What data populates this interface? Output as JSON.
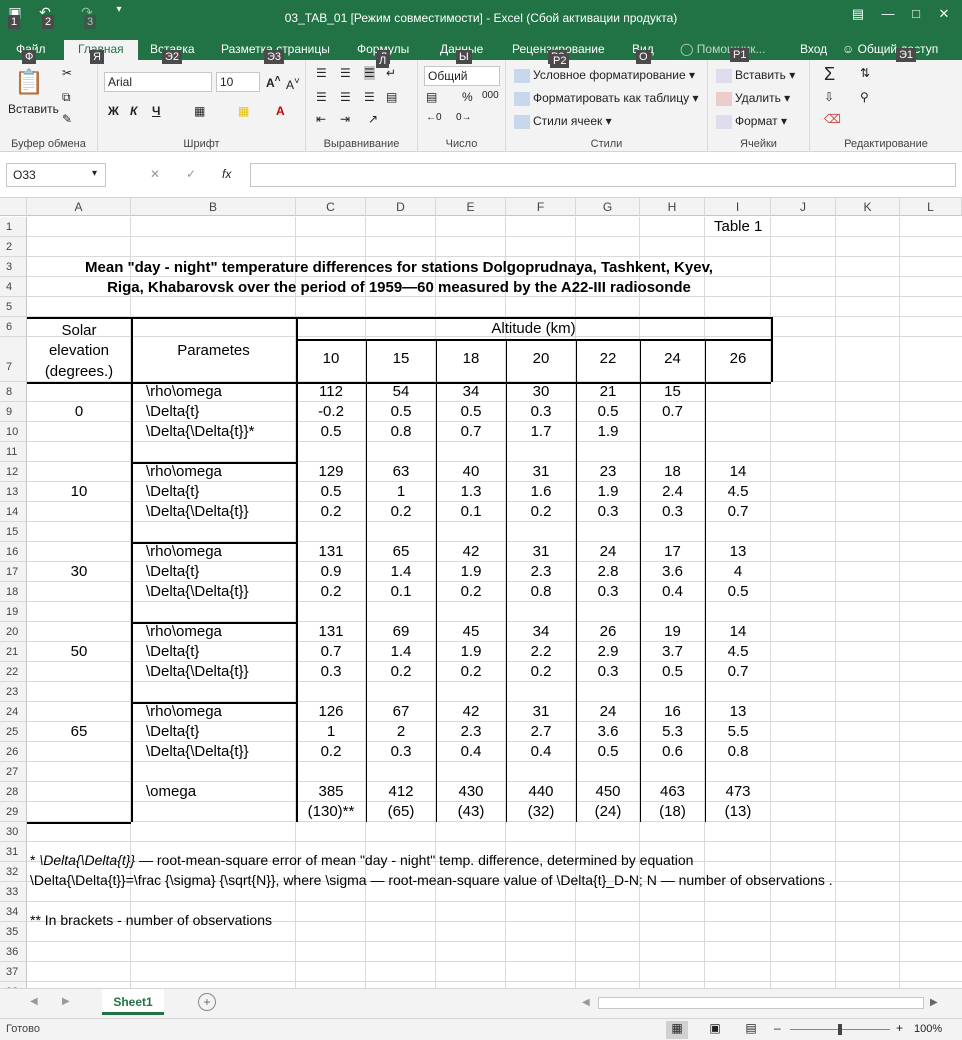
{
  "app": {
    "doc_title": "03_TAB_01  [Режим совместимости] - Excel (Сбой активации продукта)",
    "keytips_qat": [
      "1",
      "2",
      "3"
    ],
    "keytips_tabs": [
      "Ф",
      "Я",
      "Э2",
      "Э3",
      "Л",
      "Ы",
      "Р2",
      "О",
      "Р1",
      "Э1"
    ]
  },
  "tabs": [
    "Файл",
    "Главная",
    "Вставка",
    "Разметка страницы",
    "Формулы",
    "Данные",
    "Рецензирование",
    "Вид",
    "Помощник...",
    "Вход",
    "Общий доступ"
  ],
  "ribbon": {
    "clipboard": {
      "paste": "Вставить",
      "label": "Буфер обмена"
    },
    "font": {
      "name": "Arial",
      "size": "10",
      "label": "Шрифт",
      "bold": "Ж",
      "italic": "К",
      "underline": "Ч"
    },
    "alignment": {
      "label": "Выравнивание"
    },
    "number": {
      "format": "Общий",
      "label": "Число",
      "percent": "%",
      "thousands": "000"
    },
    "styles": {
      "cond": "Условное форматирование",
      "table": "Форматировать как таблицу",
      "cell": "Стили ячеек",
      "label": "Стили"
    },
    "cells": {
      "insert": "Вставить",
      "delete": "Удалить",
      "format": "Формат",
      "label": "Ячейки"
    },
    "editing": {
      "label": "Редактирование"
    }
  },
  "formula_bar": {
    "name_box": "O33",
    "fx": "fx",
    "value": ""
  },
  "columns": [
    "A",
    "B",
    "C",
    "D",
    "E",
    "F",
    "G",
    "H",
    "I",
    "J",
    "K",
    "L"
  ],
  "rows": [
    "1",
    "2",
    "3",
    "4",
    "5",
    "6",
    "7",
    "8",
    "9",
    "10",
    "11",
    "12",
    "13",
    "14",
    "15",
    "16",
    "17",
    "18",
    "19",
    "20",
    "21",
    "22",
    "23",
    "24",
    "25",
    "26",
    "27",
    "28",
    "29",
    "30",
    "31",
    "32",
    "33",
    "34",
    "35",
    "36",
    "37",
    "38"
  ],
  "sheet": {
    "table_label": "Table 1",
    "title1": "Mean \"day - night\" temperature differences for stations Dolgoprudnaya, Tashkent, Kyev,",
    "title2": "Riga, Khabarovsk over the period of 1959—60 measured by the A22-III radiosonde",
    "hdr_solar": "Solar",
    "hdr_elevation": "elevation",
    "hdr_degrees": "(degrees.)",
    "hdr_params": "Parametes",
    "hdr_altitude": "Altitude (km)",
    "altitudes": [
      "10",
      "15",
      "18",
      "20",
      "22",
      "24",
      "26"
    ],
    "groups": [
      {
        "elev": "0",
        "rows": [
          {
            "p": "\\rho\\omega",
            "v": [
              "112",
              "54",
              "34",
              "30",
              "21",
              "15",
              ""
            ]
          },
          {
            "p": "\\Delta{t}",
            "v": [
              "-0.2",
              "0.5",
              "0.5",
              "0.3",
              "0.5",
              "0.7",
              ""
            ]
          },
          {
            "p": "\\Delta{\\Delta{t}}*",
            "v": [
              "0.5",
              "0.8",
              "0.7",
              "1.7",
              "1.9",
              "",
              ""
            ]
          }
        ]
      },
      {
        "elev": "10",
        "rows": [
          {
            "p": "\\rho\\omega",
            "v": [
              "129",
              "63",
              "40",
              "31",
              "23",
              "18",
              "14"
            ]
          },
          {
            "p": "\\Delta{t}",
            "v": [
              "0.5",
              "1",
              "1.3",
              "1.6",
              "1.9",
              "2.4",
              "4.5"
            ]
          },
          {
            "p": "\\Delta{\\Delta{t}}",
            "v": [
              "0.2",
              "0.2",
              "0.1",
              "0.2",
              "0.3",
              "0.3",
              "0.7"
            ]
          }
        ]
      },
      {
        "elev": "30",
        "rows": [
          {
            "p": "\\rho\\omega",
            "v": [
              "131",
              "65",
              "42",
              "31",
              "24",
              "17",
              "13"
            ]
          },
          {
            "p": "\\Delta{t}",
            "v": [
              "0.9",
              "1.4",
              "1.9",
              "2.3",
              "2.8",
              "3.6",
              "4"
            ]
          },
          {
            "p": "\\Delta{\\Delta{t}}",
            "v": [
              "0.2",
              "0.1",
              "0.2",
              "0.8",
              "0.3",
              "0.4",
              "0.5"
            ]
          }
        ]
      },
      {
        "elev": "50",
        "rows": [
          {
            "p": "\\rho\\omega",
            "v": [
              "131",
              "69",
              "45",
              "34",
              "26",
              "19",
              "14"
            ]
          },
          {
            "p": "\\Delta{t}",
            "v": [
              "0.7",
              "1.4",
              "1.9",
              "2.2",
              "2.9",
              "3.7",
              "4.5"
            ]
          },
          {
            "p": "\\Delta{\\Delta{t}}",
            "v": [
              "0.3",
              "0.2",
              "0.2",
              "0.2",
              "0.3",
              "0.5",
              "0.7"
            ]
          }
        ]
      },
      {
        "elev": "65",
        "rows": [
          {
            "p": "\\rho\\omega",
            "v": [
              "126",
              "67",
              "42",
              "31",
              "24",
              "16",
              "13"
            ]
          },
          {
            "p": "\\Delta{t}",
            "v": [
              "1",
              "2",
              "2.3",
              "2.7",
              "3.6",
              "5.3",
              "5.5"
            ]
          },
          {
            "p": "\\Delta{\\Delta{t}}",
            "v": [
              "0.2",
              "0.3",
              "0.4",
              "0.4",
              "0.5",
              "0.6",
              "0.8"
            ]
          }
        ]
      }
    ],
    "omega_label": "\\omega",
    "omega": [
      "385",
      "412",
      "430",
      "440",
      "450",
      "463",
      "473"
    ],
    "obs": [
      "(130)**",
      "(65)",
      "(43)",
      "(32)",
      "(24)",
      "(18)",
      "(13)"
    ],
    "note31_italic": "\\Delta{\\Delta{t}}",
    "note31_prefix": "* ",
    "note31_rest": " — root-mean-square error of mean \"day - night\" temp. difference, determined by equation",
    "note32": "\\Delta{\\Delta{t}}=\\frac {\\sigma} {\\sqrt{N}}, where \\sigma — root-mean-square value of \\Delta{t}_D-N; N — number of observations .",
    "note34": "** In brackets - number of observations"
  },
  "sheet_tab": "Sheet1",
  "status": {
    "ready": "Готово",
    "zoom": "100%"
  }
}
